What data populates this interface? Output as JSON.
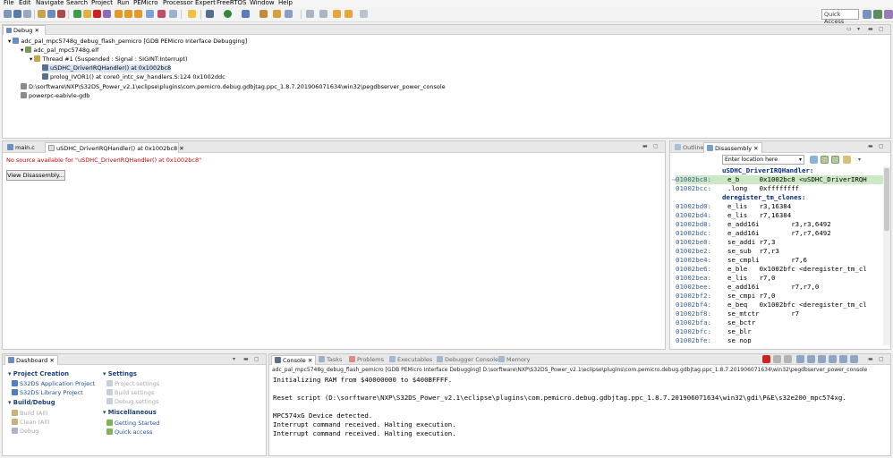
{
  "menu": [
    "File",
    "Edit",
    "Navigate",
    "Search",
    "Project",
    "Run",
    "PEMicro",
    "Processor Expert",
    "FreeRTOS",
    "Window",
    "Help"
  ],
  "toolbar": {
    "quick_access_placeholder": "Quick Access"
  },
  "debug_view": {
    "tab_label": "Debug",
    "tree": [
      {
        "label": "adc_pal_mpc5748g_debug_flash_pemicro [GDB PEMicro Interface Debugging]",
        "icon": "launch-icon",
        "level": 0
      },
      {
        "label": "adc_pal_mpc5748g.elf",
        "icon": "elf-icon",
        "level": 1
      },
      {
        "label": "Thread #1 (Suspended : Signal : SIGINT:Interrupt)",
        "icon": "thread-icon",
        "level": 2
      },
      {
        "label": "uSDHC_DriverIRQHandler() at 0x1002bc8",
        "icon": "stack-frame-icon",
        "level": 3,
        "selected": true
      },
      {
        "label": "prolog_IVOR1() at core0_intc_sw_handlers.S:124 0x1002ddc",
        "icon": "stack-frame-icon",
        "level": 3
      },
      {
        "label": "D:\\sorftware\\NXP\\S32DS_Power_v2.1\\eclipse\\plugins\\com.pemicro.debug.gdbjtag.ppc_1.8.7.201906071634\\win32\\pegdbserver_power_console",
        "icon": "process-icon",
        "level": 1
      },
      {
        "label": "powerpc-eabivle-gdb",
        "icon": "process-icon",
        "level": 1
      }
    ]
  },
  "editor": {
    "tabs": [
      {
        "label": "main.c",
        "active": false
      },
      {
        "label": "uSDHC_DriverIRQHandler() at 0x1002bc8",
        "active": true
      }
    ],
    "message": "No source available for \"uSDHC_DriverIRQHandler() at 0x1002bc8\"",
    "button_label": "View Disassembly..."
  },
  "disassembly": {
    "tabs": [
      "Outline",
      "Disassembly"
    ],
    "location_placeholder": "Enter location here",
    "lines": [
      {
        "label": "uSDHC_DriverIRQHandler:"
      },
      {
        "addr": "01002bc8:",
        "code": "e_b     0x1002bc8 <uSDHC_DriverIRQH",
        "current": true
      },
      {
        "addr": "01002bcc:",
        "code": ".long   0xffffffff"
      },
      {
        "label": "deregister_tm_clones:"
      },
      {
        "addr": "01002bd0:",
        "code": "e_lis   r3,16384"
      },
      {
        "addr": "01002bd4:",
        "code": "e_lis   r7,16384"
      },
      {
        "addr": "01002bd8:",
        "code": "e_add16i        r3,r3,6492"
      },
      {
        "addr": "01002bdc:",
        "code": "e_add16i        r7,r7,6492"
      },
      {
        "addr": "01002be0:",
        "code": "se_addi r7,3"
      },
      {
        "addr": "01002be2:",
        "code": "se_sub  r7,r3"
      },
      {
        "addr": "01002be4:",
        "code": "se_cmpli        r7,6"
      },
      {
        "addr": "01002be6:",
        "code": "e_ble   0x1002bfc <deregister_tm_cl"
      },
      {
        "addr": "01002bea:",
        "code": "e_lis   r7,0"
      },
      {
        "addr": "01002bee:",
        "code": "e_add16i        r7,r7,0"
      },
      {
        "addr": "01002bf2:",
        "code": "se_cmpi r7,0"
      },
      {
        "addr": "01002bf4:",
        "code": "e_beq   0x1002bfc <deregister_tm_cl"
      },
      {
        "addr": "01002bf8:",
        "code": "se_mtctr        r7"
      },
      {
        "addr": "01002bfa:",
        "code": "se_bctr"
      },
      {
        "addr": "01002bfc:",
        "code": "se_blr"
      },
      {
        "addr": "01002bfe:",
        "code": "se_nop"
      }
    ]
  },
  "dashboard": {
    "tab_label": "Dashboard",
    "project_creation": {
      "title": "Project Creation",
      "items": [
        "S32DS Application Project",
        "S32DS Library Project"
      ]
    },
    "build_debug": {
      "title": "Build/Debug",
      "items": [
        "Build  (All)",
        "Clean  (All)",
        "Debug"
      ]
    },
    "settings": {
      "title": "Settings",
      "items": [
        "Project settings",
        "Build settings",
        "Debug settings"
      ]
    },
    "miscellaneous": {
      "title": "Miscellaneous",
      "items": [
        "Getting Started",
        "Quick access"
      ]
    }
  },
  "console": {
    "tabs": [
      "Console",
      "Tasks",
      "Problems",
      "Executables",
      "Debugger Console",
      "Memory"
    ],
    "header": "adc_pal_mpc5748g_debug_flash_pemicro [GDB PEMicro Interface Debugging] D:\\sorftware\\NXP\\S32DS_Power_v2.1\\eclipse\\plugins\\com.pemicro.debug.gdbjtag.ppc_1.8.7.201906071634\\win32\\pegdbserver_power_console",
    "lines": [
      "Initializing RAM from $40000000 to $400BFFFF.",
      "",
      "Reset script (D:\\sorftware\\NXP\\S32DS_Power_v2.1\\eclipse\\plugins\\com.pemicro.debug.gdbjtag.ppc_1.8.7.201906071634\\win32\\gdi\\P&E\\s32e200_mpc574xg.",
      "",
      "MPC574xG Device detected.",
      "Interrupt command received. Halting execution.",
      "Interrupt command received. Halting execution."
    ]
  },
  "colors": {
    "accent": "#3a5f94",
    "error_text": "#d40000",
    "current_line": "#cde8c4",
    "link": "#1f4e9a"
  }
}
